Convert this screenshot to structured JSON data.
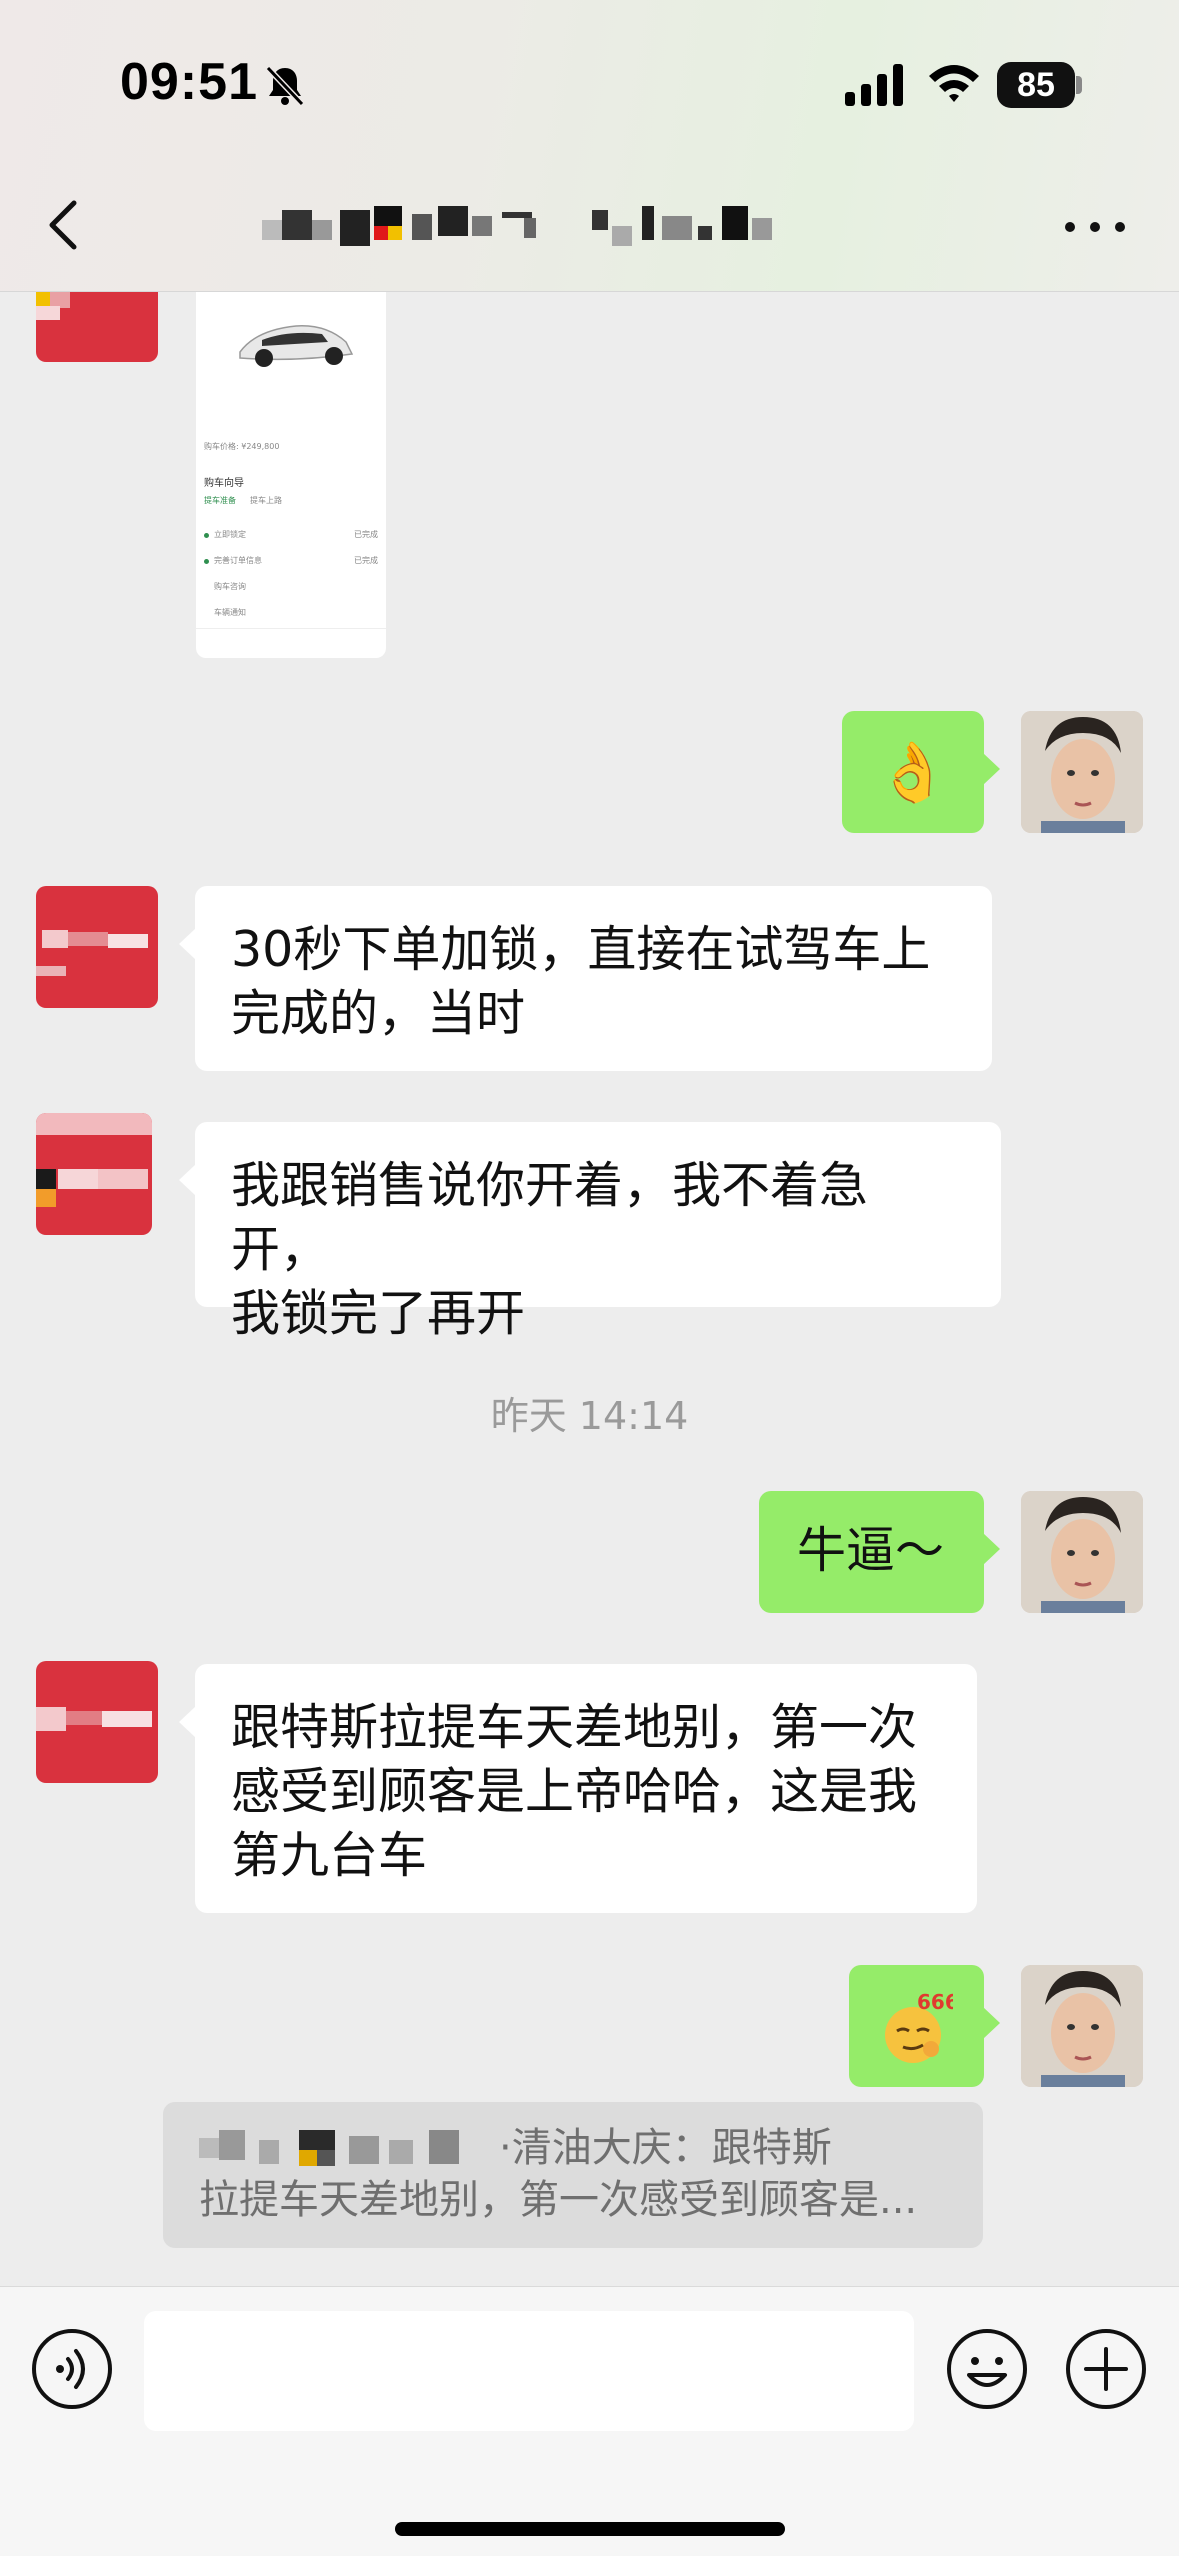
{
  "status_bar": {
    "time": "09:51",
    "battery": "85"
  },
  "header": {
    "title_icon": "chevron-left-icon",
    "more_icon": "more-dots-icon"
  },
  "messages": {
    "m1": {
      "emoji": "👌"
    },
    "m2": {
      "line1": "30秒下单加锁，直接在试驾车上",
      "line2": "完成的，当时"
    },
    "m3": {
      "line1": "我跟销售说你开着，我不着急开，",
      "line2": "我锁完了再开"
    },
    "timestamp": "昨天 14:14",
    "m4": {
      "text": "牛逼～"
    },
    "m5": {
      "line1": "跟特斯拉提车天差地别，第一次",
      "line2": "感受到顾客是上帝哈哈，这是我",
      "line3": "第九台车"
    },
    "m6": {
      "emoji": "666"
    }
  },
  "shared_image": {
    "price": "购车价格: ¥249,800",
    "section": "购车向导",
    "tab1": "提车准备",
    "tab2": "提车上路",
    "step1": "立即锁定",
    "step1_status": "已完成",
    "step2": "完善订单信息",
    "step2_status": "已完成",
    "step3": "购车咨询",
    "step4": "车辆通知"
  },
  "quote": {
    "line1": "·清油大庆：跟特斯",
    "line2": "拉提车天差地别，第一次感受到顾客是..."
  },
  "input": {
    "placeholder": ""
  },
  "colors": {
    "bubble_me": "#95ec69",
    "bubble_other": "#ffffff",
    "background": "#ededed"
  }
}
